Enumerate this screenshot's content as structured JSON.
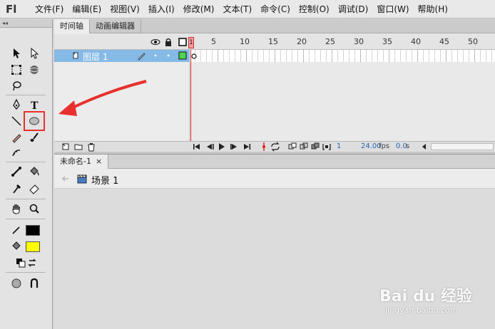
{
  "app": {
    "logo": "Fl"
  },
  "menu": [
    {
      "label": "文件(F)"
    },
    {
      "label": "编辑(E)"
    },
    {
      "label": "视图(V)"
    },
    {
      "label": "插入(I)"
    },
    {
      "label": "修改(M)"
    },
    {
      "label": "文本(T)"
    },
    {
      "label": "命令(C)"
    },
    {
      "label": "控制(O)"
    },
    {
      "label": "调试(D)"
    },
    {
      "label": "窗口(W)"
    },
    {
      "label": "帮助(H)"
    }
  ],
  "toolbox": {
    "header": "◂◂",
    "stroke_color": "#000000",
    "fill_color": "#ffff00"
  },
  "timeline": {
    "tabs": [
      "时间轴",
      "动画编辑器"
    ],
    "frame_numbers": [
      "1",
      "5",
      "10",
      "15",
      "20",
      "25",
      "30",
      "35",
      "40",
      "45",
      "50"
    ],
    "layer": {
      "name": "图层 1"
    },
    "playhead_label": "1",
    "status": {
      "frame": "1",
      "fps": "24.00",
      "fps_unit": "fps",
      "time": "0.0",
      "time_unit": "s"
    }
  },
  "document": {
    "tab_label": "未命名-1",
    "close_symbol": "×",
    "scene_label": "场景 1"
  },
  "watermark": {
    "brand": "Bai du 经验",
    "site": "jingyan.baidu.com"
  },
  "colors": {
    "accent_red": "#e8312f",
    "layer_selected": "#85b9e6",
    "status_link": "#2a63ad"
  }
}
